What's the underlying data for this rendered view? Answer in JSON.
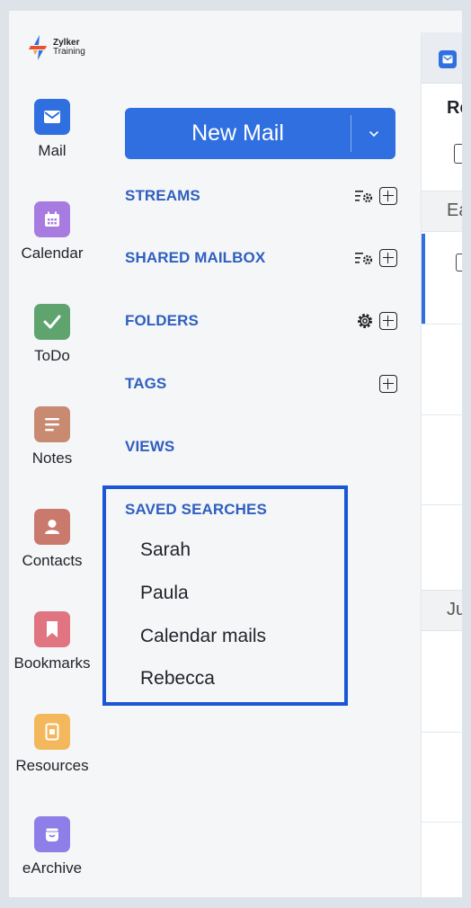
{
  "logo": {
    "line1": "Zylker",
    "line2": "Training"
  },
  "apps": [
    {
      "label": "Mail",
      "icon": "mail-icon",
      "color": "#2f6fdf"
    },
    {
      "label": "Calendar",
      "icon": "calendar-icon",
      "color": "#a77be0"
    },
    {
      "label": "ToDo",
      "icon": "check-icon",
      "color": "#5fa36f"
    },
    {
      "label": "Notes",
      "icon": "notes-icon",
      "color": "#c98a72"
    },
    {
      "label": "Contacts",
      "icon": "contact-icon",
      "color": "#c97a6c"
    },
    {
      "label": "Bookmarks",
      "icon": "bookmark-icon",
      "color": "#e07480"
    },
    {
      "label": "Resources",
      "icon": "resource-icon",
      "color": "#f3b85c"
    },
    {
      "label": "eArchive",
      "icon": "archive-icon",
      "color": "#8d7ee8"
    }
  ],
  "compose": {
    "label": "New Mail"
  },
  "sections": {
    "streams": "STREAMS",
    "shared": "SHARED MAILBOX",
    "folders": "FOLDERS",
    "tags": "TAGS",
    "views": "VIEWS",
    "saved": "SAVED SEARCHES"
  },
  "saved_searches": [
    "Sarah",
    "Paula",
    "Calendar mails",
    "Rebecca"
  ],
  "right_pane": {
    "header": "Re",
    "group1": "Ea",
    "group2": "Ju"
  },
  "colors": {
    "accent": "#2f6fdf",
    "section": "#2f5fbf",
    "highlight": "#1a56d6"
  }
}
